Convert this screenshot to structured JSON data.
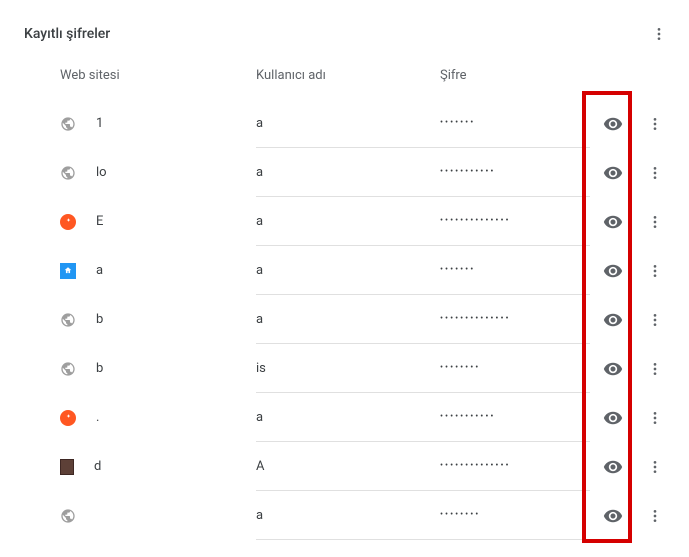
{
  "section_title": "Kayıtlı şifreler",
  "columns": {
    "site": "Web sitesi",
    "user": "Kullanıcı adı",
    "pass": "Şifre"
  },
  "rows": [
    {
      "icon": "globe",
      "site": "1",
      "user": "a",
      "pass_dots": "•••••••"
    },
    {
      "icon": "globe",
      "site": "lo",
      "user": "a",
      "pass_dots": "•••••••••••"
    },
    {
      "icon": "orange",
      "site": "E",
      "user": "a",
      "pass_dots": "••••••••••••••"
    },
    {
      "icon": "blue",
      "site": "a",
      "user": "a",
      "pass_dots": "•••••••"
    },
    {
      "icon": "globe",
      "site": "b",
      "user": "a",
      "pass_dots": "••••••••••••••"
    },
    {
      "icon": "globe",
      "site": "b",
      "user": "is",
      "pass_dots": "••••••••"
    },
    {
      "icon": "orange",
      "site": ".",
      "user": "a",
      "pass_dots": "•••••••••••"
    },
    {
      "icon": "brown",
      "site": "d",
      "user": "A",
      "pass_dots": "••••••••••••••"
    },
    {
      "icon": "globe",
      "site": "",
      "user": "a",
      "pass_dots": "••••••••"
    }
  ]
}
